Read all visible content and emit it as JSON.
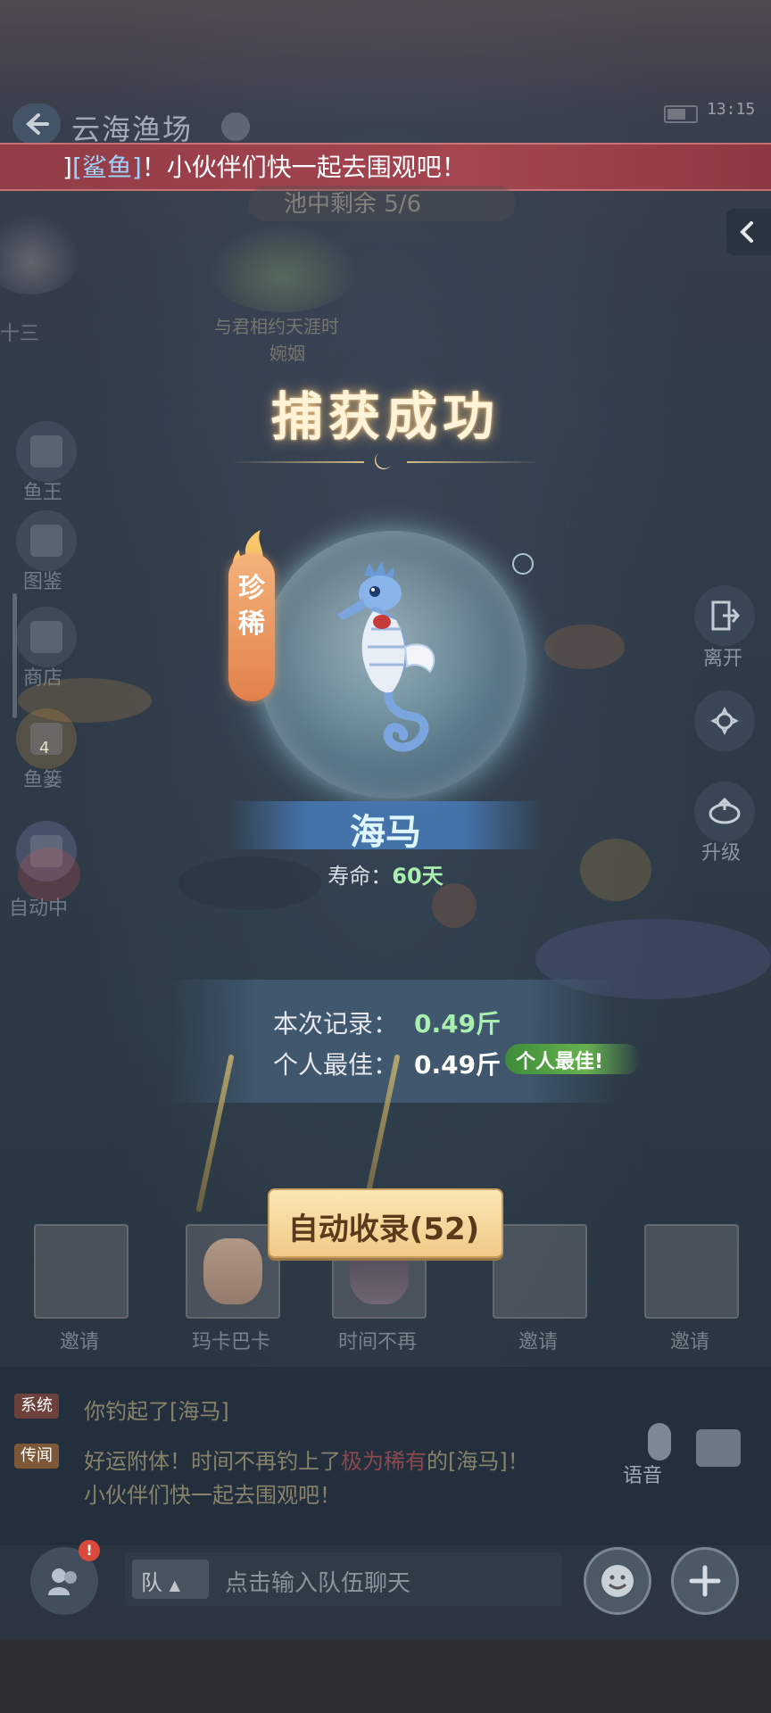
{
  "header": {
    "title": "云海渔场",
    "clock": "13:15"
  },
  "banner": {
    "prefix": "]",
    "fish": "[鲨鱼]",
    "message": "！小伙伴们快一起去围观吧！"
  },
  "pond": {
    "count_text": "池中剩余 5/6",
    "bg_text_1": "与君相约天涯时",
    "bg_text_2": "婉姻",
    "bg_text_3": "十三"
  },
  "left_menu": [
    {
      "label": "鱼王",
      "icon": "fish-king-icon"
    },
    {
      "label": "图鉴",
      "icon": "fish-catalog-icon"
    },
    {
      "label": "商店",
      "icon": "shop-icon"
    },
    {
      "label": "鱼篓",
      "icon": "fish-basket-icon",
      "badge": "4"
    },
    {
      "label": "自动中",
      "icon": "auto-icon"
    }
  ],
  "right_menu": [
    {
      "label": "离开",
      "icon": "exit-icon"
    },
    {
      "label": "",
      "icon": "settings-icon"
    },
    {
      "label": "升级",
      "icon": "upgrade-icon"
    }
  ],
  "catch": {
    "title": "捕获成功",
    "rarity": "珍稀",
    "fish_name": "海马",
    "lifespan_label": "寿命：",
    "lifespan_value": "60天",
    "record_label": "本次记录：",
    "record_value": "0.49斤",
    "best_label": "个人最佳：",
    "best_value": "0.49斤",
    "best_badge": "个人最佳!",
    "collect_button": "自动收录(52)"
  },
  "team": [
    {
      "label": "邀请",
      "type": "empty"
    },
    {
      "label": "玛卡巴卡",
      "type": "player"
    },
    {
      "label": "时间不再",
      "type": "player"
    },
    {
      "label": "邀请",
      "type": "empty"
    },
    {
      "label": "邀请",
      "type": "empty"
    }
  ],
  "chat": {
    "messages": [
      {
        "tag": "系统",
        "text": "你钓起了[海马]"
      },
      {
        "tag": "传闻",
        "text_a": "好运附体！时间不再钓上了",
        "text_red": "极为稀有",
        "text_b": "的[海马]！",
        "line2": "小伙伴们快一起去围观吧！"
      }
    ],
    "voice_label": "语音",
    "channel": "队",
    "placeholder": "点击输入队伍聊天",
    "notification_count": "!"
  },
  "colors": {
    "banner": "#a8464f",
    "highlight_green": "#a9f0b0",
    "collect_button": "#f2c987",
    "rarity_orange": "#e2804b"
  }
}
